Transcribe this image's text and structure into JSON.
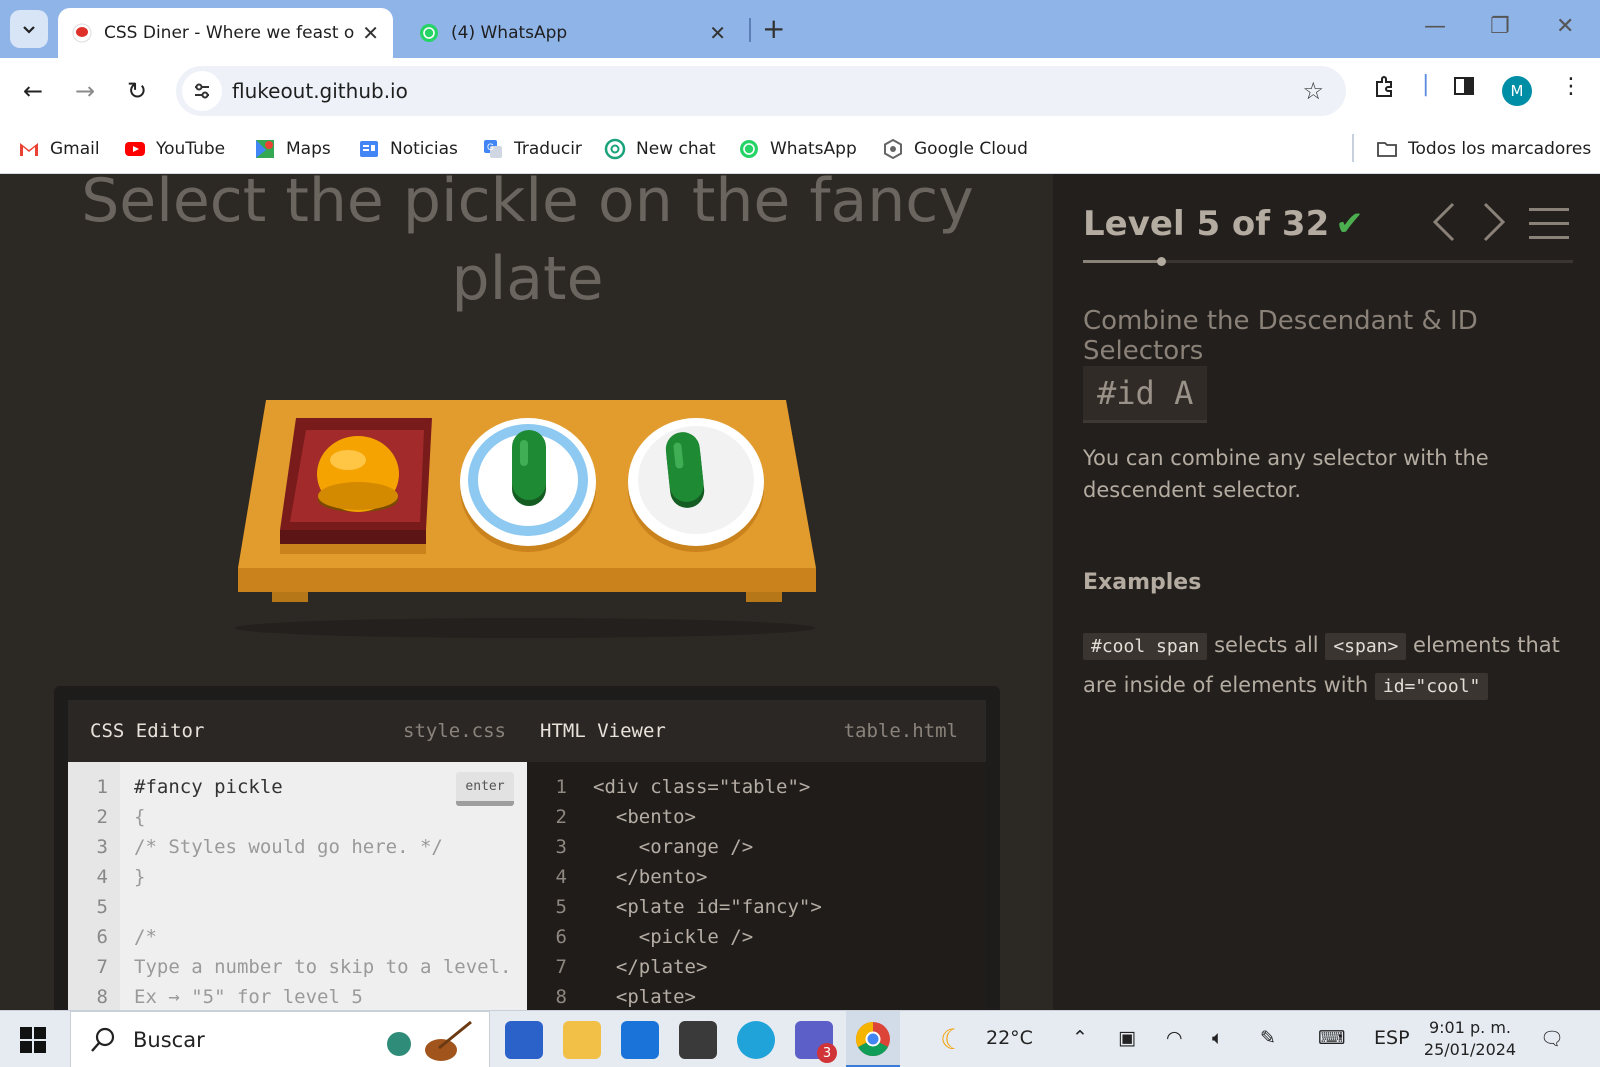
{
  "browser": {
    "tabs": [
      {
        "title": "CSS Diner - Where we feast on CSS",
        "active": true
      },
      {
        "title": "(4) WhatsApp",
        "active": false
      }
    ],
    "new_tab_label": "+",
    "address": "flukeout.github.io",
    "avatar_letter": "M",
    "bookmarks": [
      "Gmail",
      "YouTube",
      "Maps",
      "Noticias",
      "Traducir",
      "New chat",
      "WhatsApp",
      "Google Cloud"
    ],
    "all_bookmarks": "Todos los marcadores"
  },
  "game": {
    "instruction": "Select the pickle on the fancy plate",
    "level": "Level 5 of 32",
    "level_progress": 0.16,
    "selector_name": "Combine the Descendant & ID Selectors",
    "syntax": "#id A",
    "hint": "You can combine any selector with the descendent selector.",
    "examples_title": "Examples",
    "example": {
      "code1": "#cool span",
      "text1": "selects all",
      "code2": "<span>",
      "text2": "elements that are inside of elements with",
      "code3": "id=\"cool\""
    }
  },
  "editor": {
    "css_title": "CSS Editor",
    "css_file": "style.css",
    "html_title": "HTML Viewer",
    "html_file": "table.html",
    "enter_label": "enter",
    "css_lines": [
      {
        "n": "1",
        "text": "#fancy pickle"
      },
      {
        "n": "2",
        "text": "{"
      },
      {
        "n": "3",
        "text": "/* Styles would go here. */"
      },
      {
        "n": "4",
        "text": "}"
      },
      {
        "n": "5",
        "text": ""
      },
      {
        "n": "6",
        "text": "/*"
      },
      {
        "n": "7",
        "text": "Type a number to skip to a level."
      },
      {
        "n": "8",
        "text": "Ex → \"5\" for level 5"
      }
    ],
    "html_lines": [
      {
        "n": "1",
        "text": "<div class=\"table\">"
      },
      {
        "n": "2",
        "text": "  <bento>"
      },
      {
        "n": "3",
        "text": "    <orange />"
      },
      {
        "n": "4",
        "text": "  </bento>"
      },
      {
        "n": "5",
        "text": "  <plate id=\"fancy\">"
      },
      {
        "n": "6",
        "text": "    <pickle />"
      },
      {
        "n": "7",
        "text": "  </plate>"
      },
      {
        "n": "8",
        "text": "  <plate>"
      }
    ]
  },
  "taskbar": {
    "search_placeholder": "Buscar",
    "weather": "22°C",
    "language": "ESP",
    "time": "9:01 p. m.",
    "date": "25/01/2024",
    "teams_badge": "3"
  },
  "colors": {
    "accent_check": "#4cae4f",
    "table": "#e29b2d",
    "pickle": "#1f8a34",
    "orange": "#f5a300",
    "fancy_plate_rim": "#8ec9f2",
    "bento": "#a22a2b"
  }
}
